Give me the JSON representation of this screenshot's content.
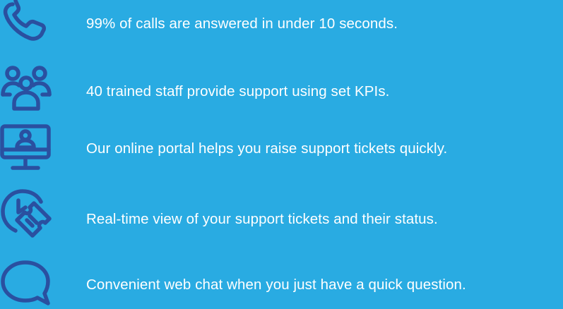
{
  "colors": {
    "background": "#29abe2",
    "icon": "#2a50a0",
    "text": "#ffffff"
  },
  "features": [
    {
      "icon": "phone-icon",
      "text": "99% of calls are answered in under 10 seconds."
    },
    {
      "icon": "team-icon",
      "text": "40 trained staff provide support using set KPIs."
    },
    {
      "icon": "monitor-user-icon",
      "text": "Our online portal helps you raise support tickets quickly."
    },
    {
      "icon": "clock-ticket-icon",
      "text": "Real-time view of your support tickets and their status."
    },
    {
      "icon": "chat-bubble-icon",
      "text": "Convenient web chat when you just have a quick question."
    }
  ]
}
